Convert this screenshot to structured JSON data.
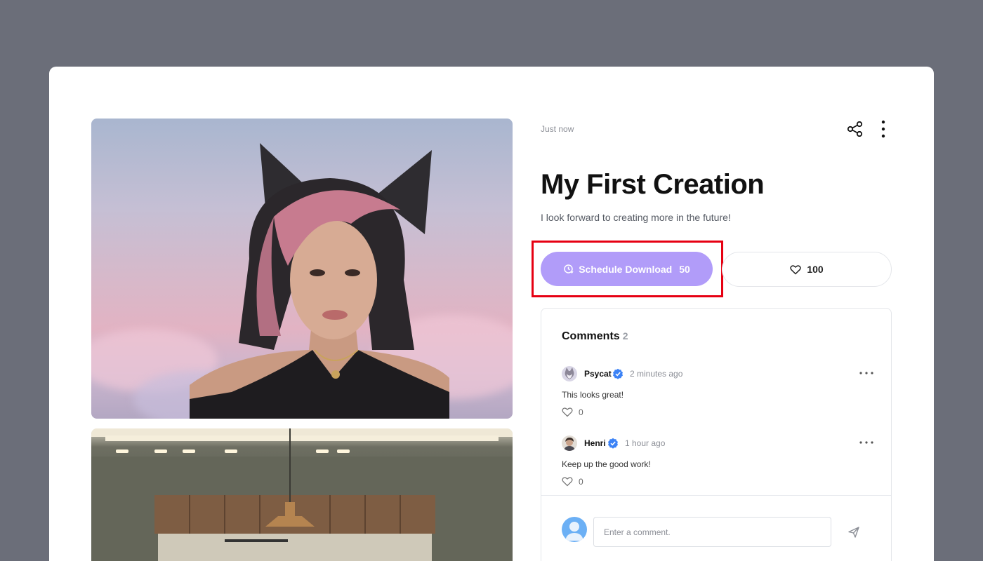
{
  "post": {
    "time": "Just now",
    "title": "My First Creation",
    "description": "I look forward to creating more in the future!"
  },
  "actions": {
    "schedule_label": "Schedule Download",
    "schedule_count": "50",
    "likes": "100",
    "accent_color": "#b19cf9"
  },
  "comments": {
    "heading": "Comments",
    "count": "2",
    "items": [
      {
        "author": "Psycat",
        "time": "2 minutes ago",
        "text": "This looks great!",
        "likes": "0"
      },
      {
        "author": "Henri",
        "time": "1 hour ago",
        "text": "Keep up the good work!",
        "likes": "0"
      }
    ],
    "input_placeholder": "Enter a comment."
  },
  "icons": [
    "share-icon",
    "more-vertical-icon",
    "clock-download-icon",
    "heart-icon",
    "verified-badge-icon",
    "more-horizontal-icon",
    "send-icon",
    "user-avatar-icon"
  ]
}
